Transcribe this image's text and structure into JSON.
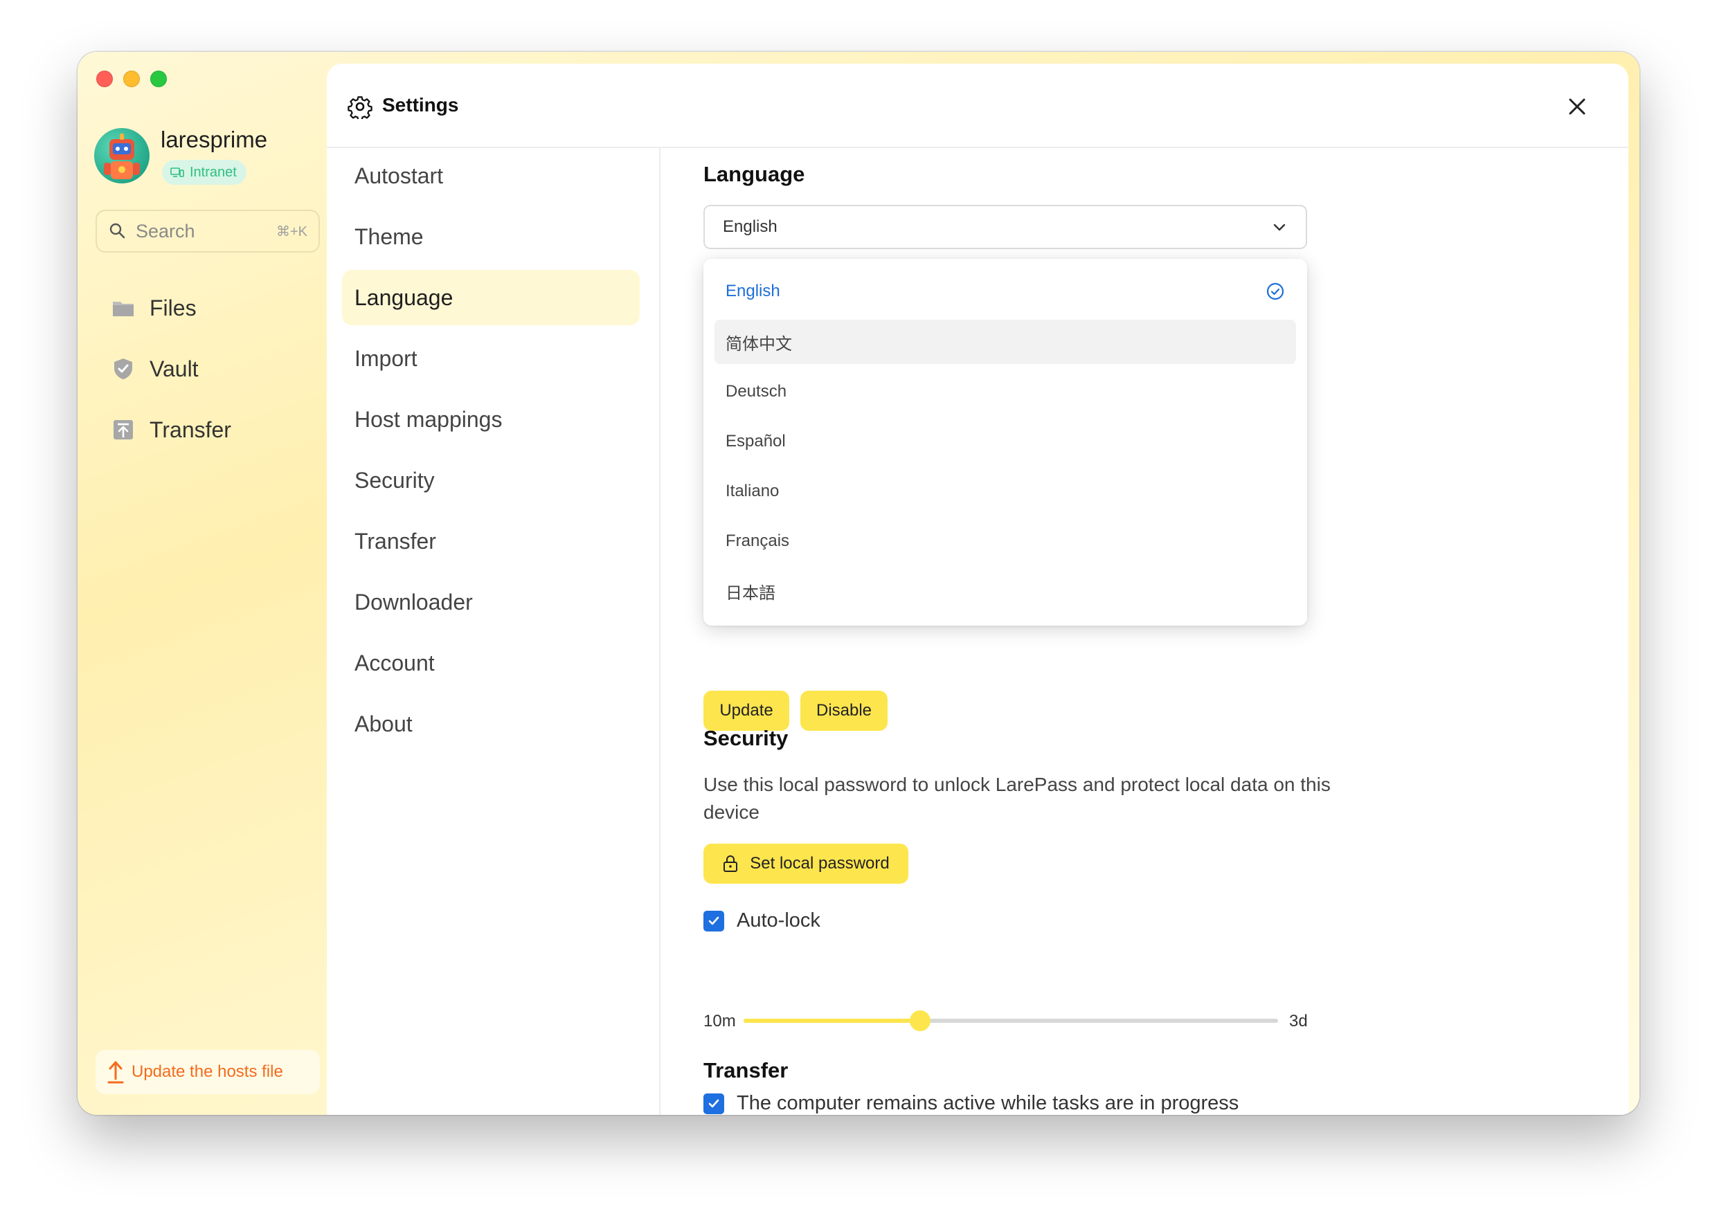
{
  "sidebar": {
    "username": "laresprime",
    "network_badge": "Intranet",
    "search_placeholder": "Search",
    "search_shortcut": "⌘+K",
    "nav": [
      {
        "label": "Files",
        "icon": "folder-icon"
      },
      {
        "label": "Vault",
        "icon": "shield-check-icon"
      },
      {
        "label": "Transfer",
        "icon": "upload-box-icon"
      }
    ],
    "update_hosts_label": "Update the hosts file"
  },
  "panel": {
    "title": "Settings",
    "menu": [
      {
        "label": "Autostart",
        "active": false
      },
      {
        "label": "Theme",
        "active": false
      },
      {
        "label": "Language",
        "active": true
      },
      {
        "label": "Import",
        "active": false
      },
      {
        "label": "Host mappings",
        "active": false
      },
      {
        "label": "Security",
        "active": false
      },
      {
        "label": "Transfer",
        "active": false
      },
      {
        "label": "Downloader",
        "active": false
      },
      {
        "label": "Account",
        "active": false
      },
      {
        "label": "About",
        "active": false
      }
    ]
  },
  "language": {
    "title": "Language",
    "selected": "English",
    "options": [
      "English",
      "简体中文",
      "Deutsch",
      "Español",
      "Italiano",
      "Français",
      "日本語"
    ],
    "hovered": "简体中文",
    "update_label": "Update",
    "disable_label": "Disable"
  },
  "security": {
    "title": "Security",
    "description": "Use this local password to unlock LarePass and protect local data on this device",
    "set_password_label": "Set local password",
    "autolock_label": "Auto-lock",
    "autolock_checked": true,
    "slider_min": "10m",
    "slider_max": "3d",
    "slider_fraction": 0.33
  },
  "transfer": {
    "title": "Transfer",
    "keep_awake_label": "The computer remains active while tasks are in progress",
    "keep_awake_checked": true
  },
  "colors": {
    "accent_yellow": "#fde54e",
    "selected_blue": "#1d6fd8",
    "checkbox_blue": "#1e6fe0",
    "warning_orange": "#f46b1e",
    "badge_green": "#2fbf7f"
  }
}
